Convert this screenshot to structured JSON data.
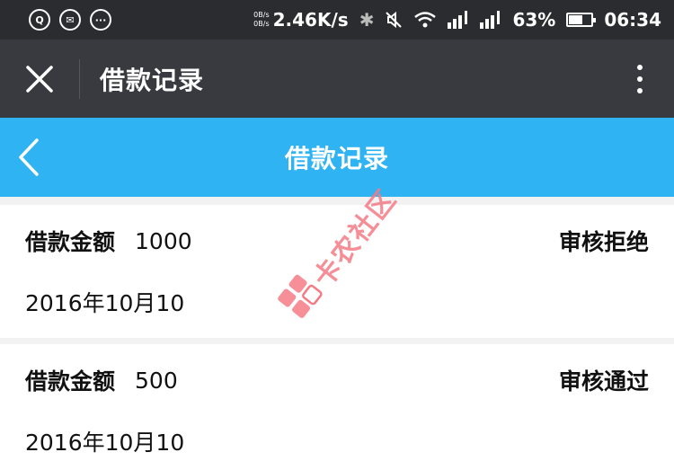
{
  "status_bar": {
    "speed_units_up": "0B/s",
    "speed_units_down": "0B/s",
    "network_speed": "2.46K/s",
    "battery_percent": "63%",
    "battery_level": 0.63,
    "time": "06:34"
  },
  "top_bar": {
    "title": "借款记录"
  },
  "header": {
    "title": "借款记录"
  },
  "records": [
    {
      "amount_label": "借款金额",
      "amount": "1000",
      "status": "审核拒绝",
      "date": "2016年10月10"
    },
    {
      "amount_label": "借款金额",
      "amount": "500",
      "status": "审核通过",
      "date": "2016年10月10"
    }
  ],
  "watermark": {
    "text": "卡农社区"
  },
  "colors": {
    "status_bar_bg": "#2b2c30",
    "top_bar_bg": "#393a3f",
    "header_bg": "#2fb3f2",
    "watermark": "#f47b86"
  }
}
